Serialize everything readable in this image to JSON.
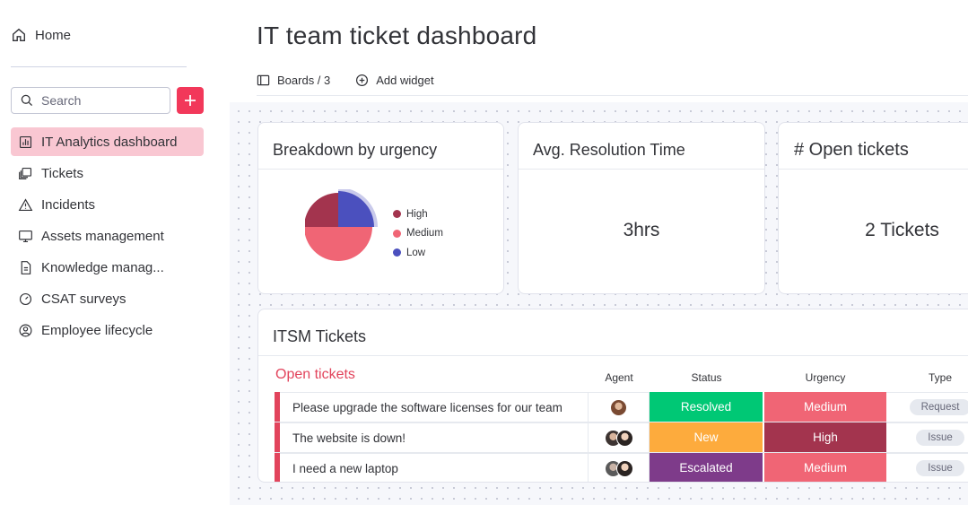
{
  "sidebar": {
    "home": "Home",
    "search_placeholder": "Search",
    "items": [
      {
        "label": "IT Analytics dashboard",
        "icon": "chart-icon",
        "active": true
      },
      {
        "label": "Tickets",
        "icon": "board-stack-icon"
      },
      {
        "label": "Incidents",
        "icon": "warning-icon"
      },
      {
        "label": "Assets management",
        "icon": "monitor-icon"
      },
      {
        "label": "Knowledge manag...",
        "icon": "document-icon"
      },
      {
        "label": "CSAT surveys",
        "icon": "gauge-icon"
      },
      {
        "label": "Employee lifecycle",
        "icon": "person-circle-icon"
      }
    ]
  },
  "header": {
    "title": "IT team ticket dashboard",
    "boards_label": "Boards / 3",
    "add_widget_label": "Add widget"
  },
  "widgets": {
    "urgency": {
      "title": "Breakdown by urgency",
      "legend": [
        {
          "label": "High",
          "color": "#a3344e"
        },
        {
          "label": "Medium",
          "color": "#f06575"
        },
        {
          "label": "Low",
          "color": "#4b50be"
        }
      ]
    },
    "resolution": {
      "title": "Avg. Resolution Time",
      "value": "3hrs"
    },
    "open": {
      "title": "# Open tickets",
      "value": "2 Tickets"
    }
  },
  "chart_data": {
    "type": "pie",
    "categories": [
      "High",
      "Medium",
      "Low"
    ],
    "values": [
      1,
      2,
      1
    ],
    "colors": [
      "#a3344e",
      "#f06575",
      "#4b50be"
    ]
  },
  "tickets": {
    "title": "ITSM Tickets",
    "group": "Open tickets",
    "columns": {
      "agent": "Agent",
      "status": "Status",
      "urgency": "Urgency",
      "type": "Type"
    },
    "rows": [
      {
        "name": "Please upgrade the software licenses for our team",
        "status": "Resolved",
        "status_color": "#00c875",
        "urgency": "Medium",
        "urgency_color": "#f06575",
        "type": "Request",
        "agents": 1
      },
      {
        "name": "The website is down!",
        "status": "New",
        "status_color": "#fdab3d",
        "urgency": "High",
        "urgency_color": "#a3344e",
        "type": "Issue",
        "agents": 2
      },
      {
        "name": "I need a new laptop",
        "status": "Escalated",
        "status_color": "#7e3b8a",
        "urgency": "Medium",
        "urgency_color": "#f06575",
        "type": "Issue",
        "agents": 2
      }
    ]
  }
}
